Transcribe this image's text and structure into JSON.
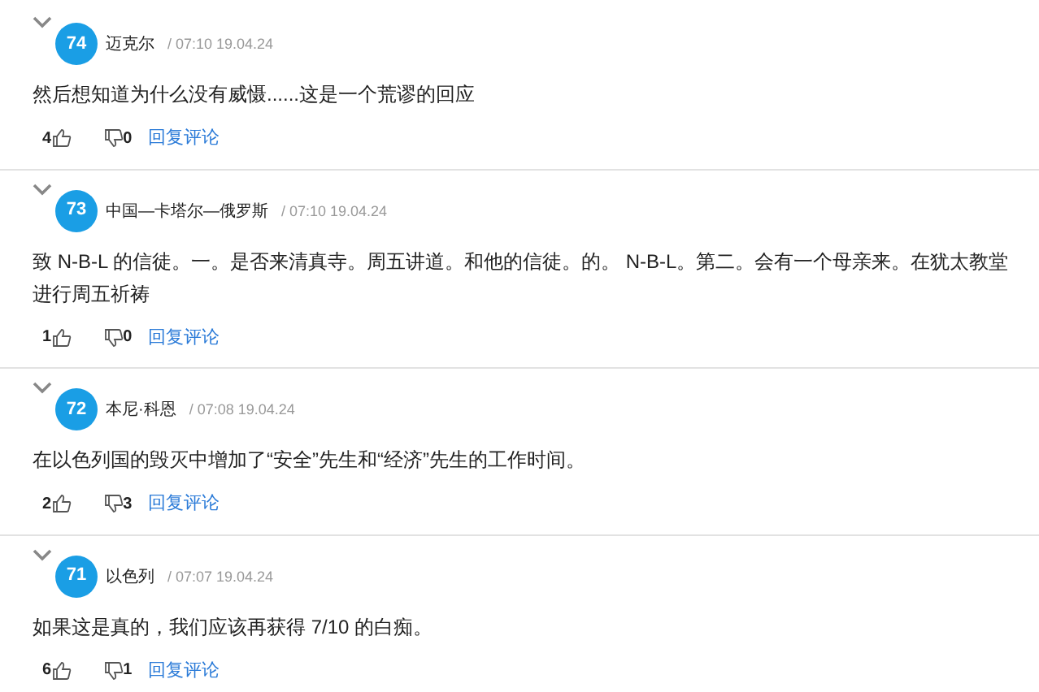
{
  "comments": [
    {
      "number": "74",
      "author": "迈克尔",
      "time": "/ 07:10 19.04.24",
      "text": "然后想知道为什么没有威慑......这是一个荒谬的回应",
      "likes": "4",
      "dislikes": "0",
      "reply": "回复评论"
    },
    {
      "number": "73",
      "author": "中国—卡塔尔—俄罗斯",
      "time": "/ 07:10 19.04.24",
      "text": "致 N-B-L 的信徒。一。是否来清真寺。周五讲道。和他的信徒。的。 N-B-L。第二。会有一个母亲来。在犹太教堂进行周五祈祷",
      "likes": "1",
      "dislikes": "0",
      "reply": "回复评论"
    },
    {
      "number": "72",
      "author": "本尼·科恩",
      "time": "/ 07:08 19.04.24",
      "text": "在以色列国的毁灭中增加了“安全”先生和“经济”先生的工作时间。",
      "likes": "2",
      "dislikes": "3",
      "reply": "回复评论"
    },
    {
      "number": "71",
      "author": "以色列",
      "time": "/ 07:07 19.04.24",
      "text": "如果这是真的，我们应该再获得 7/10 的白痴。",
      "likes": "6",
      "dislikes": "1",
      "reply": "回复评论"
    }
  ]
}
